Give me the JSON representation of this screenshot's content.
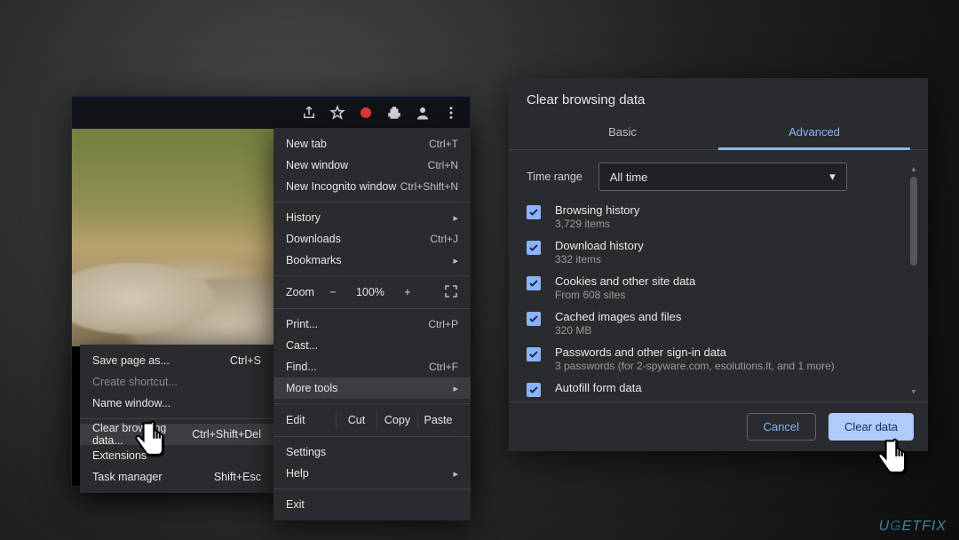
{
  "toolbar_icons": [
    "share-icon",
    "star-icon",
    "record-icon",
    "extensions-icon",
    "profile-icon",
    "kebab-icon"
  ],
  "menu": {
    "newTab": {
      "label": "New tab",
      "shortcut": "Ctrl+T"
    },
    "newWindow": {
      "label": "New window",
      "shortcut": "Ctrl+N"
    },
    "incognito": {
      "label": "New Incognito window",
      "shortcut": "Ctrl+Shift+N"
    },
    "history": {
      "label": "History"
    },
    "downloads": {
      "label": "Downloads",
      "shortcut": "Ctrl+J"
    },
    "bookmarks": {
      "label": "Bookmarks"
    },
    "zoom": {
      "label": "Zoom",
      "value": "100%",
      "minus": "−",
      "plus": "+"
    },
    "print": {
      "label": "Print...",
      "shortcut": "Ctrl+P"
    },
    "cast": {
      "label": "Cast..."
    },
    "find": {
      "label": "Find...",
      "shortcut": "Ctrl+F"
    },
    "moreTools": {
      "label": "More tools"
    },
    "edit": {
      "label": "Edit",
      "cut": "Cut",
      "copy": "Copy",
      "paste": "Paste"
    },
    "settings": {
      "label": "Settings"
    },
    "help": {
      "label": "Help"
    },
    "exit": {
      "label": "Exit"
    }
  },
  "submenu": {
    "savePage": {
      "label": "Save page as...",
      "shortcut": "Ctrl+S"
    },
    "createShortcut": {
      "label": "Create shortcut..."
    },
    "nameWindow": {
      "label": "Name window..."
    },
    "clearData": {
      "label": "Clear browsing data...",
      "shortcut": "Ctrl+Shift+Del"
    },
    "extensions": {
      "label": "Extensions"
    },
    "taskManager": {
      "label": "Task manager",
      "shortcut": "Shift+Esc"
    }
  },
  "dialog": {
    "title": "Clear browsing data",
    "tabs": {
      "basic": "Basic",
      "advanced": "Advanced"
    },
    "timeRange": {
      "label": "Time range",
      "value": "All time"
    },
    "options": [
      {
        "title": "Browsing history",
        "sub": "3,729 items",
        "checked": true
      },
      {
        "title": "Download history",
        "sub": "332 items",
        "checked": true
      },
      {
        "title": "Cookies and other site data",
        "sub": "From 608 sites",
        "checked": true
      },
      {
        "title": "Cached images and files",
        "sub": "320 MB",
        "checked": true
      },
      {
        "title": "Passwords and other sign-in data",
        "sub": "3 passwords (for 2-spyware.com, esolutions.lt, and 1 more)",
        "checked": true
      },
      {
        "title": "Autofill form data",
        "sub": "",
        "checked": true
      }
    ],
    "buttons": {
      "cancel": "Cancel",
      "clear": "Clear data"
    }
  },
  "watermark": "UGETFIX"
}
